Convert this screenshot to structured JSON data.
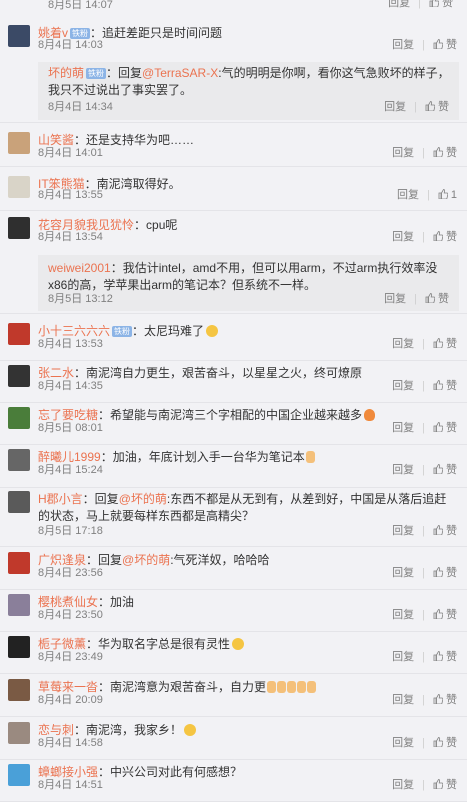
{
  "top_partial": {
    "time": "8月5日 14:07",
    "reply": "回复",
    "like": "赞"
  },
  "labels": {
    "reply": "回复",
    "like": "赞"
  },
  "comments": [
    {
      "user": "姚着v",
      "badge": "铁粉",
      "text": "：追赶差距只是时间问题",
      "time": "8月4日 14:03",
      "likes": "",
      "avatar": "avatar-1",
      "reply": {
        "user": "坏的萌",
        "badge": "铁粉",
        "pre": "：回复",
        "at": "@TerraSAR-X",
        "text": ":气的明明是你啊，看你这气急败坏的样子，我只不过说出了事实罢了。",
        "time": "8月4日 14:34"
      }
    },
    {
      "user": "山笑酱",
      "text": "：还是支持华为吧……",
      "time": "8月4日 14:01",
      "likes": "",
      "avatar": "avatar-2"
    },
    {
      "user": "IT笨熊猫",
      "text": "：南泥湾取得好。",
      "time": "8月4日 13:55",
      "likes": "1",
      "avatar": "avatar-3"
    },
    {
      "user": "花容月貌我见犹怜",
      "text": "：cpu呢",
      "time": "8月4日 13:54",
      "likes": "",
      "avatar": "avatar-4",
      "reply": {
        "user": "weiwei2001",
        "text": "：我估计intel，amd不用，但可以用arm，不过arm执行效率没x86的高，学苹果出arm的笔记本？但系统不一样。",
        "time": "8月5日 13:12"
      }
    },
    {
      "user": "小十三六六六",
      "badge": "铁粉",
      "text": "：太尼玛难了",
      "time": "8月4日 13:53",
      "likes": "",
      "avatar": "avatar-5",
      "emoji": "smile"
    },
    {
      "user": "张二水",
      "text": "：南泥湾自力更生，艰苦奋斗，以星星之火，终可燎原",
      "time": "8月4日 14:35",
      "likes": "",
      "avatar": "avatar-6"
    },
    {
      "user": "忘了要吃糖",
      "text": "：希望能与南泥湾三个字相配的中国企业越来越多",
      "time": "8月5日 08:01",
      "likes": "",
      "avatar": "avatar-7",
      "emoji": "fire"
    },
    {
      "user": "醉曦儿1999",
      "text": "：加油，年底计划入手一台华为笔记本",
      "time": "8月4日 15:24",
      "likes": "",
      "avatar": "avatar-8",
      "emoji": "hand"
    },
    {
      "user": "H郡小言",
      "pre": "：回复",
      "at": "@坏的萌",
      "text": ":东西不都是从无到有，从差到好，中国是从落后追赶的状态，马上就要每样东西都是高精尖？",
      "time": "8月5日 17:18",
      "likes": "",
      "avatar": "avatar-9"
    },
    {
      "user": "广炽逢泉",
      "pre": "：回复",
      "at": "@坏的萌",
      "text": ":气死洋奴，哈哈哈",
      "time": "8月4日 23:56",
      "likes": "",
      "avatar": "avatar-10"
    },
    {
      "user": "樱桃煮仙女",
      "text": "：加油",
      "time": "8月4日 23:50",
      "likes": "",
      "avatar": "avatar-11"
    },
    {
      "user": "栀子微薰",
      "text": "：华为取名字总是很有灵性",
      "time": "8月4日 23:49",
      "likes": "",
      "avatar": "avatar-12",
      "emoji": "smile"
    },
    {
      "user": "草莓来一沓",
      "text": "：南泥湾意为艰苦奋斗，自力更",
      "time": "8月4日 20:09",
      "likes": "",
      "avatar": "avatar-13",
      "emoji": "hands"
    },
    {
      "user": "恋与刺",
      "text": "：南泥湾，我家乡！",
      "time": "8月4日 14:58",
      "likes": "",
      "avatar": "avatar-14",
      "emoji": "smile"
    },
    {
      "user": "蟑螂接小强",
      "text": "：中兴公司对此有何感想？",
      "time": "8月4日 14:51",
      "likes": "",
      "avatar": "avatar-15"
    }
  ],
  "colors": {
    "username": "#eb7350",
    "meta": "#808080",
    "reply_bg": "#eaeaec"
  }
}
